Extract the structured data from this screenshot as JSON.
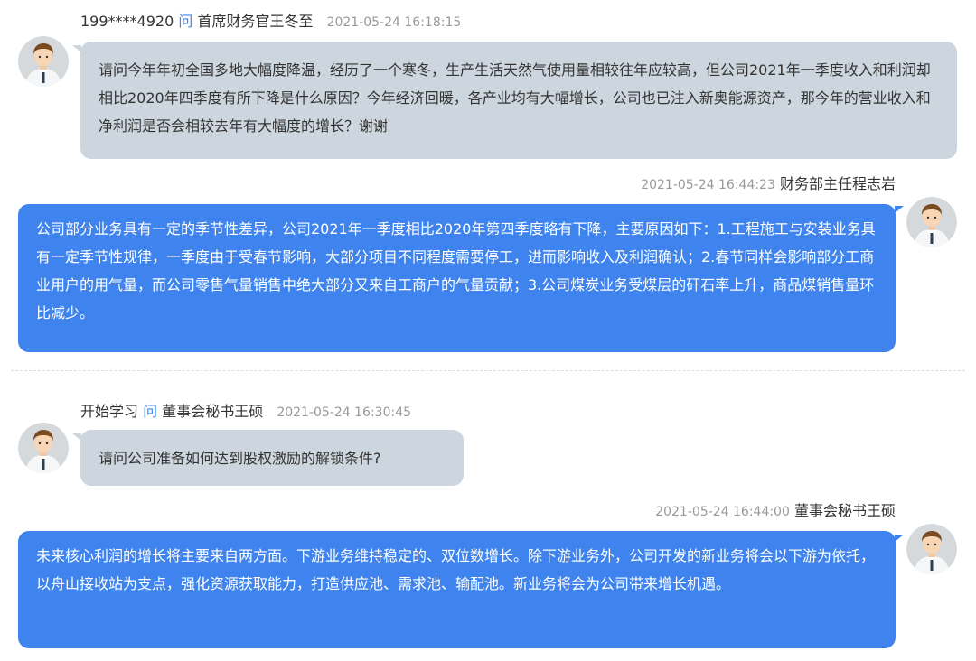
{
  "colors": {
    "question_bubble": "#cdd6de",
    "answer_bubble": "#3f84ee",
    "accent": "#3d85f0",
    "timestamp": "#999999"
  },
  "threads": [
    {
      "question": {
        "asker": "199****4920",
        "ask_word": "问",
        "target": "首席财务官王冬至",
        "time": "2021-05-24 16:18:15",
        "text": "请问今年年初全国多地大幅度降温，经历了一个寒冬，生产生活天然气使用量相较往年应较高，但公司2021年一季度收入和利润却相比2020年四季度有所下降是什么原因？今年经济回暖，各产业均有大幅增长，公司也已注入新奥能源资产，那今年的营业收入和净利润是否会相较去年有大幅度的增长？谢谢",
        "avatar_icon": "person-avatar-icon"
      },
      "answer": {
        "time": "2021-05-24 16:44:23",
        "responder": "财务部主任程志岩",
        "text": "公司部分业务具有一定的季节性差异，公司2021年一季度相比2020年第四季度略有下降，主要原因如下：1.工程施工与安装业务具有一定季节性规律，一季度由于受春节影响，大部分项目不同程度需要停工，进而影响收入及利润确认；2.春节同样会影响部分工商业用户的用气量，而公司零售气量销售中绝大部分又来自工商户的气量贡献；3.公司煤炭业务受煤层的矸石率上升，商品煤销售量环比减少。",
        "avatar_icon": "person-avatar-icon"
      }
    },
    {
      "question": {
        "asker": "开始学习",
        "ask_word": "问",
        "target": "董事会秘书王硕",
        "time": "2021-05-24 16:30:45",
        "text": "请问公司准备如何达到股权激励的解锁条件?",
        "avatar_icon": "person-avatar-icon"
      },
      "answer": {
        "time": "2021-05-24 16:44:00",
        "responder": "董事会秘书王硕",
        "text": "未来核心利润的增长将主要来自两方面。下游业务维持稳定的、双位数增长。除下游业务外，公司开发的新业务将会以下游为依托，以舟山接收站为支点，强化资源获取能力，打造供应池、需求池、输配池。新业务将会为公司带来增长机遇。",
        "avatar_icon": "person-avatar-icon"
      }
    }
  ]
}
